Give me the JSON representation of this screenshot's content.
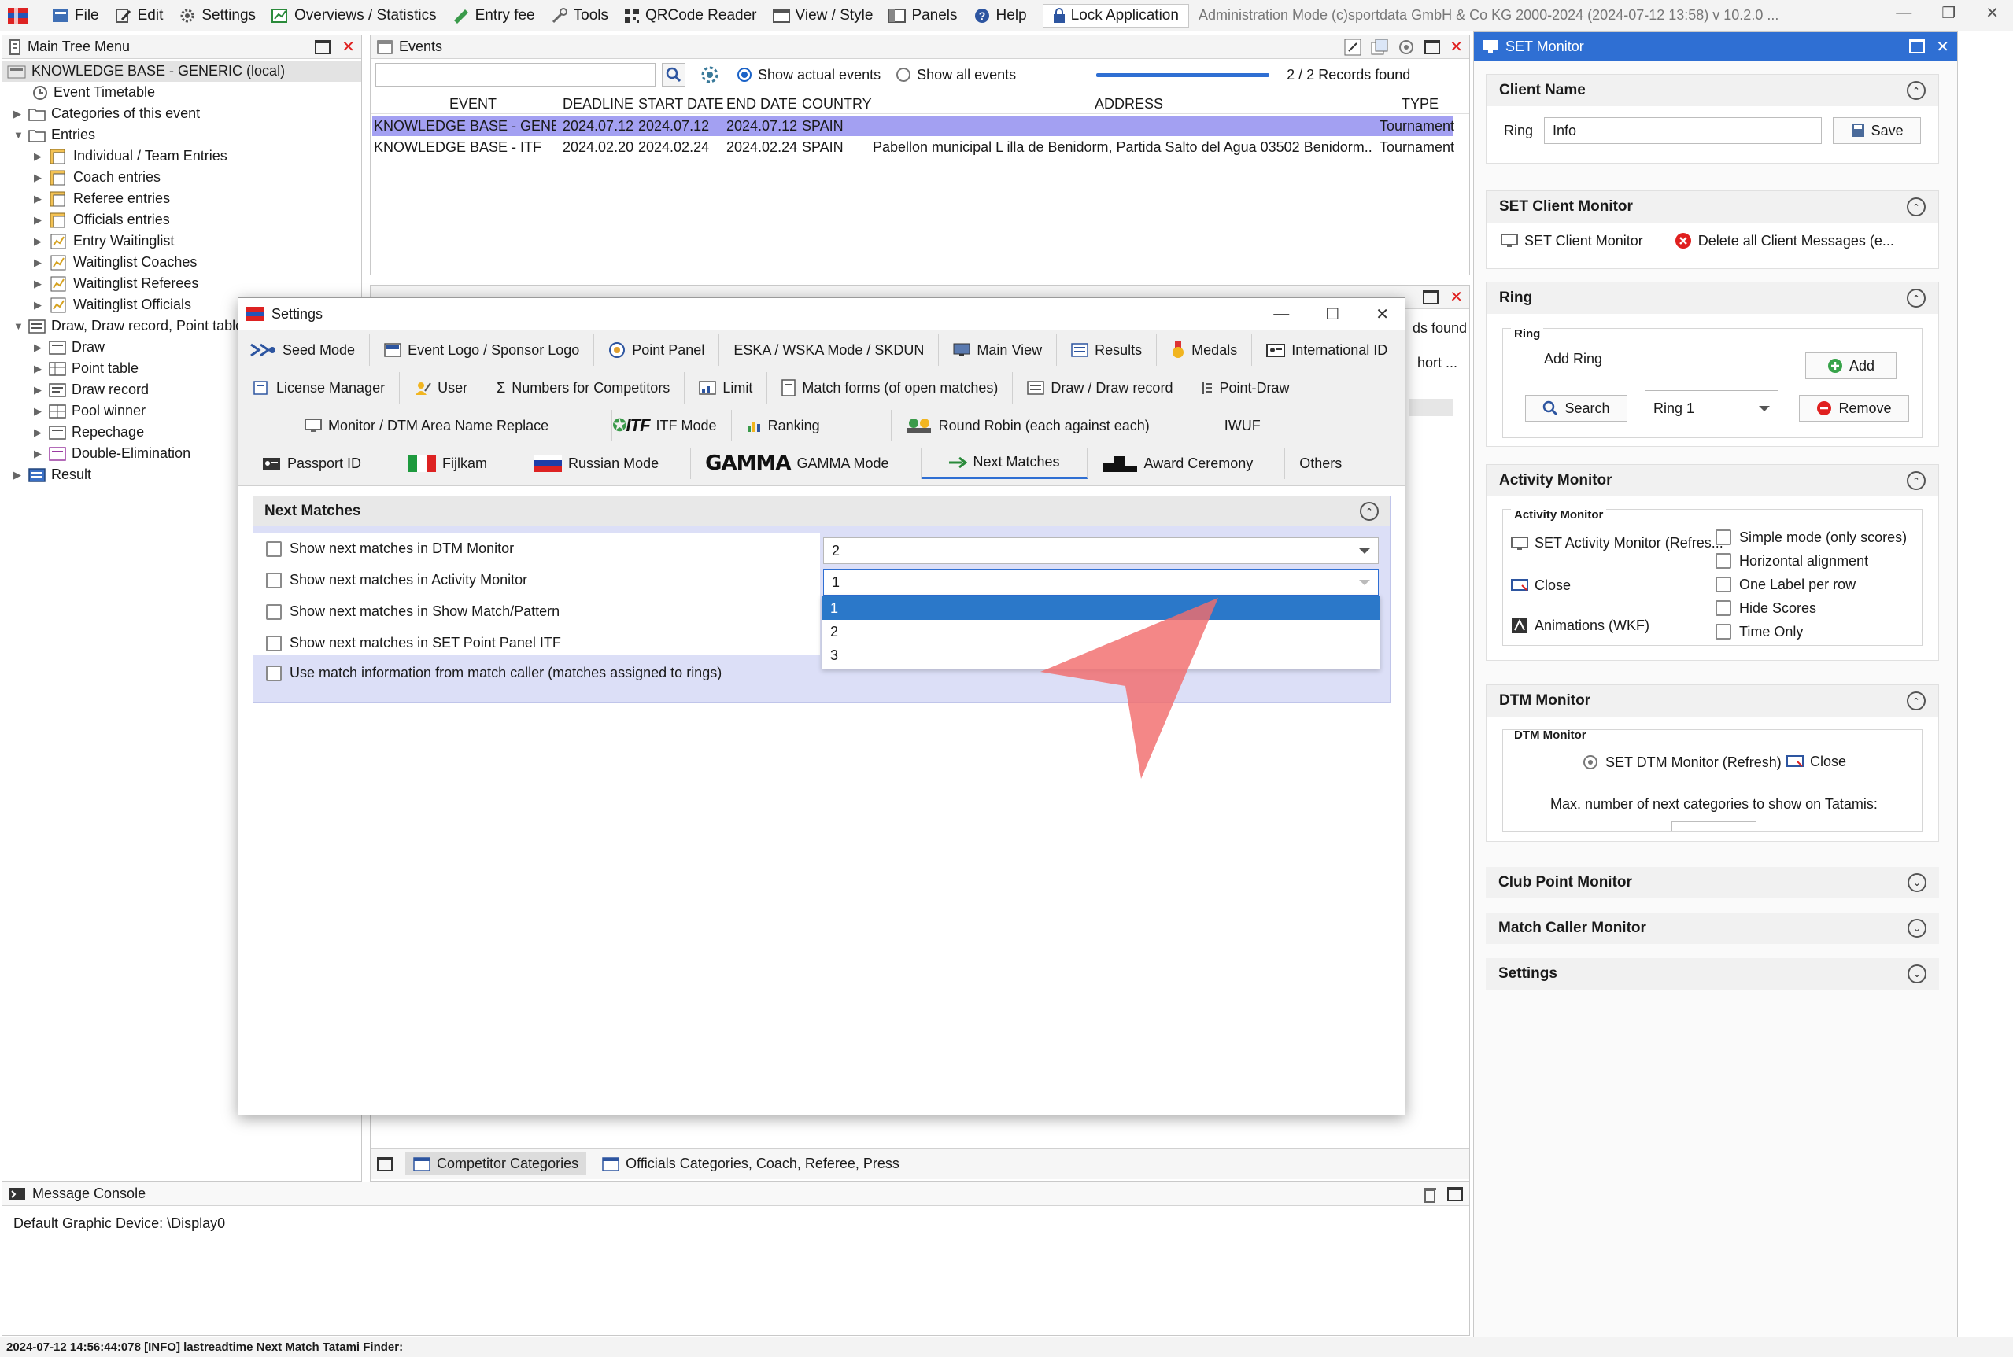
{
  "menubar": {
    "items": [
      "File",
      "Edit",
      "Settings",
      "Overviews / Statistics",
      "Entry fee",
      "Tools",
      "QRCode Reader",
      "View / Style",
      "Panels",
      "Help"
    ],
    "lock_label": "Lock Application",
    "mode_text": "Administration Mode (c)sportdata GmbH & Co KG 2000-2024 (2024-07-12 13:58)  v 10.2.0 ..."
  },
  "tree": {
    "title": "Main Tree Menu",
    "items": [
      {
        "label": "KNOWLEDGE BASE - GENERIC (local)"
      },
      {
        "label": "Event Timetable"
      },
      {
        "label": "Categories of this event"
      },
      {
        "label": "Entries"
      },
      {
        "label": "Individual / Team Entries"
      },
      {
        "label": "Coach entries"
      },
      {
        "label": "Referee entries"
      },
      {
        "label": "Officials entries"
      },
      {
        "label": "Entry Waitinglist"
      },
      {
        "label": "Waitinglist Coaches"
      },
      {
        "label": "Waitinglist Referees"
      },
      {
        "label": "Waitinglist Officials"
      },
      {
        "label": "Draw, Draw record, Point table"
      },
      {
        "label": "Draw"
      },
      {
        "label": "Point table"
      },
      {
        "label": "Draw record"
      },
      {
        "label": "Pool winner"
      },
      {
        "label": "Repechage"
      },
      {
        "label": "Double-Elimination"
      },
      {
        "label": "Result"
      }
    ]
  },
  "events": {
    "title": "Events",
    "search_value": "",
    "radio_actual": "Show actual events",
    "radio_all": "Show all events",
    "records": "2 / 2 Records found",
    "columns": [
      "EVENT",
      "DEADLINE",
      "START DATE",
      "END DATE",
      "COUNTRY",
      "ADDRESS",
      "TYPE"
    ],
    "rows": [
      [
        "KNOWLEDGE BASE - GENE...",
        "2024.07.12",
        "2024.07.12",
        "2024.07.12",
        "SPAIN",
        "",
        "Tournament"
      ],
      [
        "KNOWLEDGE BASE - ITF",
        "2024.02.20",
        "2024.02.24",
        "2024.02.24",
        "SPAIN",
        "Pabellon municipal L illa de Benidorm, Partida Salto del Agua 03502 Benidorm...",
        "Tournament"
      ]
    ]
  },
  "competitor_panel": {
    "title": "Competitor Categories",
    "records_partial": "ds found",
    "sort_partial": "hort ...",
    "bottom_tabs": [
      "Competitor Categories",
      "Officials Categories, Coach, Referee, Press"
    ]
  },
  "dialog": {
    "title": "Settings",
    "tabs_row1": [
      "Seed Mode",
      "Event Logo / Sponsor Logo",
      "Point Panel",
      "ESKA / WSKA Mode / SKDUN",
      "Main View",
      "Results",
      "Medals",
      "International ID"
    ],
    "tabs_row2": [
      "License Manager",
      "User",
      "Numbers for Competitors",
      "Limit",
      "Match forms (of open matches)",
      "Draw / Draw record",
      "Point-Draw"
    ],
    "tabs_row3": [
      "Monitor / DTM Area Name Replace",
      "ITF Mode",
      "Ranking",
      "Round Robin (each against each)",
      "IWUF"
    ],
    "tabs_row4": [
      "Passport ID",
      "Fijlkam",
      "Russian Mode",
      "GAMMA Mode",
      "Next Matches",
      "Award Ceremony",
      "Others"
    ],
    "gamma_logo": "GAMMA",
    "itf_logo": "ITF",
    "section_title": "Next Matches",
    "options": [
      "Show next matches in DTM Monitor",
      "Show next matches in Activity Monitor",
      "Show next matches in Show Match/Pattern",
      "Show next matches in SET Point Panel ITF",
      "Use match information from match caller (matches assigned to rings)"
    ],
    "dtm_value": "2",
    "activity_value": "1",
    "dropdown_options": [
      "1",
      "2",
      "3"
    ]
  },
  "monitor": {
    "title": "SET Monitor",
    "client_name": {
      "title": "Client Name",
      "ring_label": "Ring",
      "ring_value": "Info",
      "save": "Save"
    },
    "set_client": {
      "title": "SET Client Monitor",
      "btn1": "SET Client Monitor",
      "btn2": "Delete all Client Messages (e..."
    },
    "ring": {
      "title": "Ring",
      "group": "Ring",
      "add_ring": "Add Ring",
      "add": "Add",
      "search": "Search",
      "ring_value": "Ring 1",
      "remove": "Remove"
    },
    "activity": {
      "title": "Activity Monitor",
      "group": "Activity Monitor",
      "set_btn": "SET Activity Monitor (Refres...",
      "close": "Close",
      "animations": "Animations (WKF)",
      "checks": [
        "Simple mode (only scores)",
        "Horizontal alignment",
        "One Label per row",
        "Hide Scores",
        "Time Only"
      ]
    },
    "dtm": {
      "title": "DTM Monitor",
      "group": "DTM Monitor",
      "set_btn": "SET DTM Monitor (Refresh)",
      "close": "Close",
      "max_label": "Max. number of next categories to show on Tatamis:"
    },
    "collapsed": [
      "Club Point Monitor",
      "Match Caller Monitor",
      "Settings"
    ]
  },
  "console": {
    "title": "Message Console",
    "text": "Default Graphic Device: \\Display0"
  },
  "status": "2024-07-12 14:56:44:078 [INFO] lastreadtime Next Match Tatami Finder:",
  "colors": {
    "selection": "#a3a0f2",
    "accent": "#2f6fd3",
    "close_red": "#e0201f",
    "pointer": "#f26d6d"
  }
}
